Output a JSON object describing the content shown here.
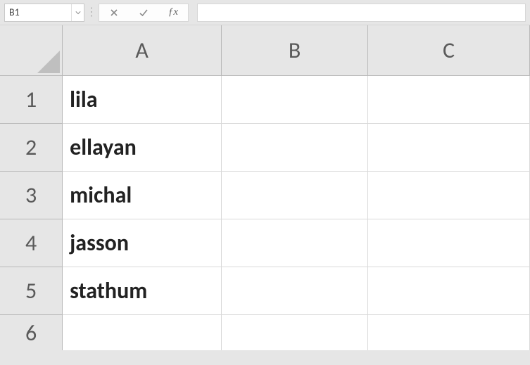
{
  "formula_bar": {
    "name_box_value": "B1",
    "formula_value": ""
  },
  "columns": [
    "A",
    "B",
    "C"
  ],
  "row_numbers": [
    "1",
    "2",
    "3",
    "4",
    "5",
    "6"
  ],
  "cells": {
    "A1": "lila",
    "A2": "ellayan",
    "A3": "michal",
    "A4": "jasson",
    "A5": "stathum",
    "A6": "",
    "B1": "",
    "B2": "",
    "B3": "",
    "B4": "",
    "B5": "",
    "B6": "",
    "C1": "",
    "C2": "",
    "C3": "",
    "C4": "",
    "C5": "",
    "C6": ""
  },
  "chart_data": {
    "type": "table",
    "columns": [
      "A"
    ],
    "rows": [
      [
        "lila"
      ],
      [
        "ellayan"
      ],
      [
        "michal"
      ],
      [
        "jasson"
      ],
      [
        "stathum"
      ]
    ]
  }
}
